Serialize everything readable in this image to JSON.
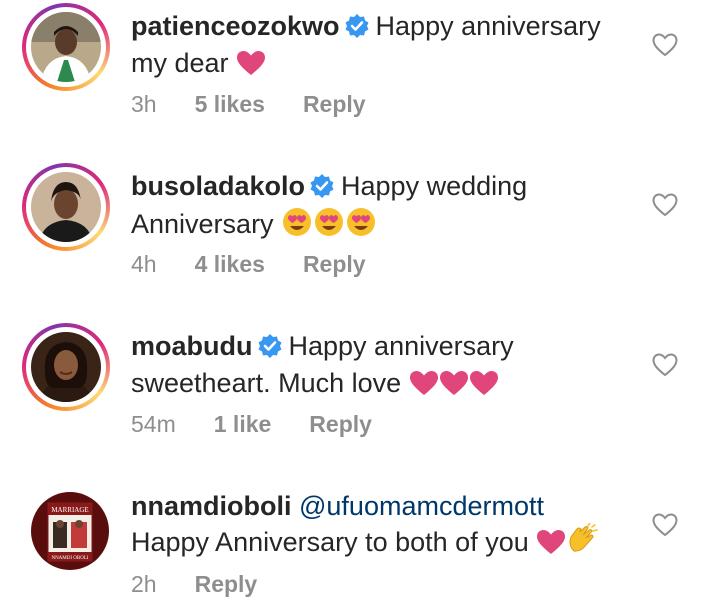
{
  "comments": [
    {
      "username": "patienceozokwo",
      "verified": true,
      "text_line1": "Happy anniversary",
      "text_line2": "my dear",
      "emojis": [
        "pink-heart"
      ],
      "time": "3h",
      "likes": "5 likes",
      "reply": "Reply"
    },
    {
      "username": "busoladakolo",
      "verified": true,
      "text_line1": "Happy wedding",
      "text_line2": "Anniversary",
      "emojis": [
        "heart-eyes",
        "heart-eyes",
        "heart-eyes"
      ],
      "time": "4h",
      "likes": "4 likes",
      "reply": "Reply"
    },
    {
      "username": "moabudu",
      "verified": true,
      "text_line1": "Happy anniversary",
      "text_line2": "sweetheart. Much love",
      "emojis": [
        "pink-heart",
        "pink-heart",
        "pink-heart"
      ],
      "time": "54m",
      "likes": "1 like",
      "reply": "Reply"
    },
    {
      "username": "nnamdioboli",
      "verified": false,
      "mention": "@ufuomamcdermott",
      "text_line2": "Happy Anniversary to both of you",
      "emojis": [
        "pink-heart",
        "clapping-hands"
      ],
      "time": "2h",
      "reply": "Reply",
      "avatar_book_title": "MARRIAGE",
      "avatar_book_author": "NNAMDI OBOLI"
    }
  ],
  "colors": {
    "verified_blue": "#3897f0",
    "heart_pink": "#e0457b",
    "meta_gray": "#8e8e8e",
    "mention_blue": "#00376b"
  }
}
